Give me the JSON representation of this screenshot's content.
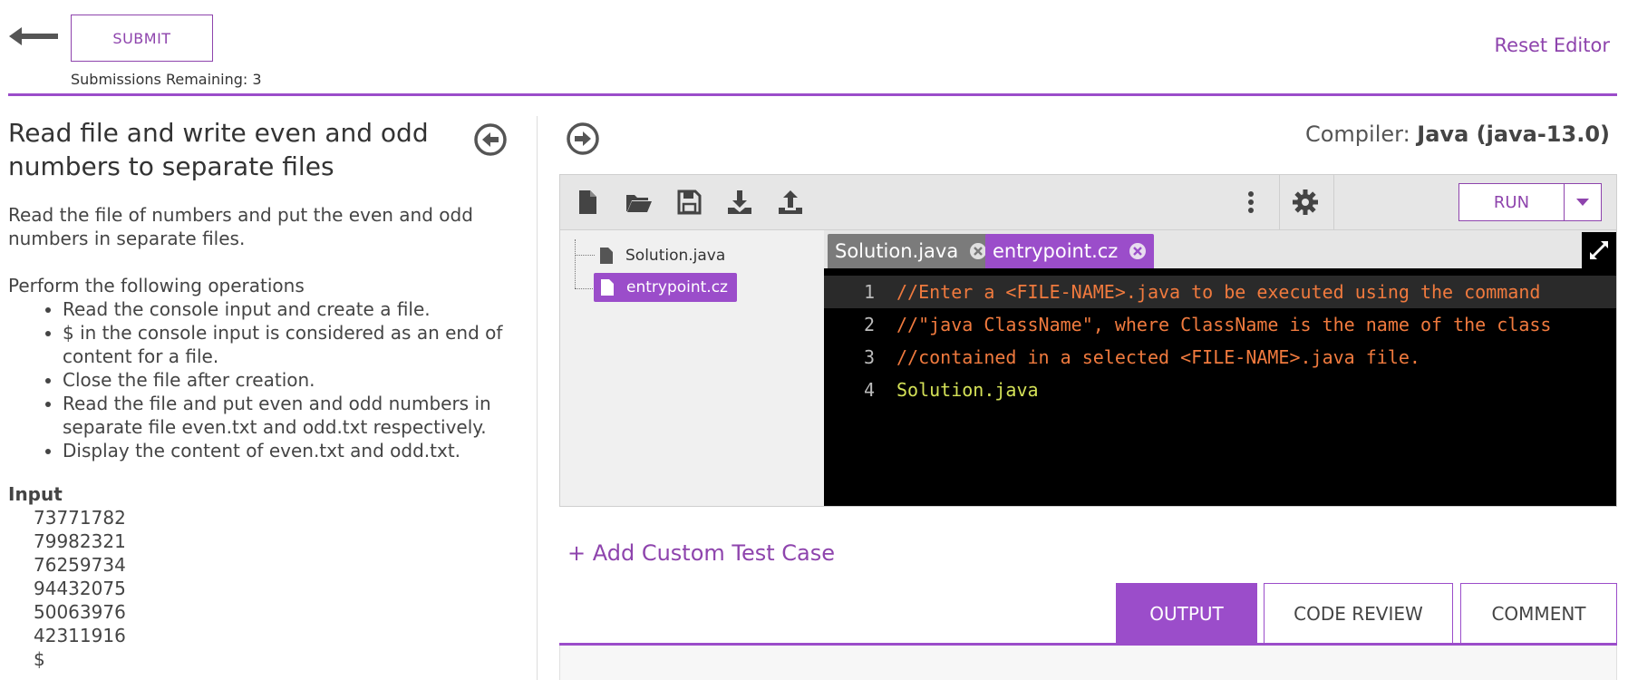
{
  "header": {
    "submit_label": "SUBMIT",
    "submissions_remaining": "Submissions Remaining: 3",
    "reset_editor_label": "Reset Editor"
  },
  "problem": {
    "title": "Read file and write even and odd numbers to separate files",
    "description": "Read the file of numbers and put the even and odd numbers in separate files.",
    "operations_heading": "Perform the following operations",
    "operations": [
      "Read the console input and create a file.",
      "$ in the console input is considered as an end of content for a file.",
      "Close the file after creation.",
      "Read the file and put even and odd numbers in separate file even.txt and odd.txt respectively.",
      "Display the content of even.txt and odd.txt."
    ],
    "input_heading": "Input",
    "input_lines": [
      "73771782",
      "79982321",
      "76259734",
      "94432075",
      "50063976",
      "42311916",
      "$"
    ]
  },
  "compiler": {
    "label": "Compiler:",
    "value": "Java (java-13.0)"
  },
  "editor": {
    "run_label": "RUN",
    "toolbar_icons": [
      "new-file-icon",
      "open-folder-icon",
      "save-icon",
      "download-icon",
      "upload-icon",
      "more-vertical-icon",
      "settings-gear-icon"
    ],
    "files": [
      {
        "name": "Solution.java",
        "active": false
      },
      {
        "name": "entrypoint.cz",
        "active": true
      }
    ],
    "tabs": [
      {
        "name": "Solution.java",
        "active": false
      },
      {
        "name": "entrypoint.cz",
        "active": true
      }
    ],
    "code": [
      {
        "num": "1",
        "text": "//Enter a <FILE-NAME>.java to be executed using the command",
        "kind": "comment"
      },
      {
        "num": "2",
        "text": "//\"java ClassName\", where ClassName is the name of the class",
        "kind": "comment"
      },
      {
        "num": "3",
        "text": "//contained in a selected <FILE-NAME>.java file.",
        "kind": "comment"
      },
      {
        "num": "4",
        "text": "Solution.java",
        "kind": "plain"
      }
    ]
  },
  "add_test_case_label": "+ Add Custom Test Case",
  "result_tabs": [
    {
      "label": "OUTPUT",
      "active": true
    },
    {
      "label": "CODE REVIEW",
      "active": false
    },
    {
      "label": "COMMENT",
      "active": false
    }
  ],
  "colors": {
    "accent": "#9b4dca",
    "comment": "#f07a3e",
    "code_text": "#d4e157"
  }
}
